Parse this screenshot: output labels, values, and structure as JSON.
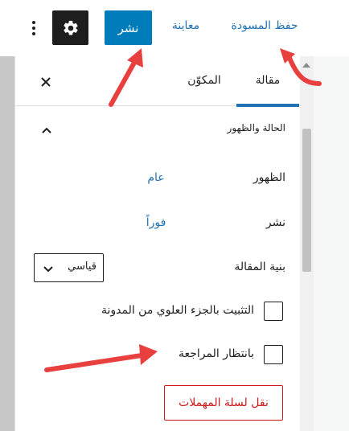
{
  "toolbar": {
    "save_draft_label": "حفظ المسودة",
    "preview_label": "معاينة",
    "publish_label": "نشر",
    "settings_icon": "gear-icon",
    "more_icon": "vertical-ellipsis-icon"
  },
  "sidebar": {
    "tabs": [
      {
        "label": "مقالة",
        "active": true
      },
      {
        "label": "المكوّن",
        "active": false
      }
    ],
    "close_icon": "close-icon",
    "section": {
      "title": "الحالة والظهور",
      "toggle_icon": "chevron-up-icon",
      "visibility": {
        "label": "الظهور",
        "value": "عام"
      },
      "publish": {
        "label": "نشر",
        "value": "فوراً"
      },
      "post_format": {
        "label": "بنية المقالة",
        "selected": "قياسي"
      },
      "stick_to_top": {
        "label": "التثبيت بالجزء العلوي من المدونة",
        "checked": false
      },
      "pending_review": {
        "label": "بانتظار المراجعة",
        "checked": false
      },
      "trash_label": "نقل لسلة المهملات"
    }
  },
  "colors": {
    "accent": "#2271b1",
    "publish_bg": "#007cba",
    "danger": "#cc1818",
    "annotation": "#e8403f"
  }
}
